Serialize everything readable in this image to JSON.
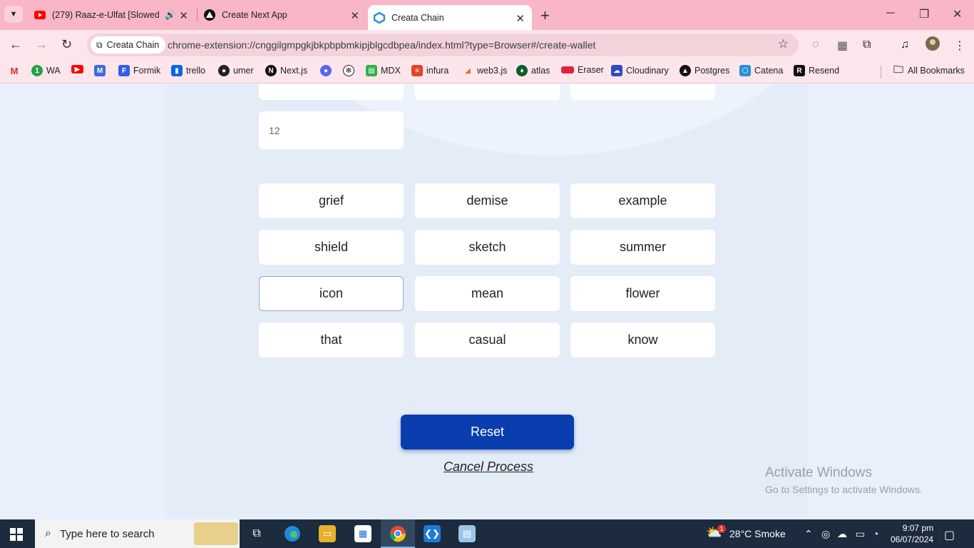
{
  "browser": {
    "tabs": [
      {
        "title": "(279) Raaz-e-Ulfat [Slowed -",
        "icon": "youtube-icon"
      },
      {
        "title": "Create Next App",
        "icon": "nextjs-icon"
      },
      {
        "title": "Creata Chain",
        "icon": "creata-chain-icon",
        "active": true
      }
    ],
    "site_chip": "Creata Chain",
    "url": "chrome-extension://cnggilgmpgkjbkpbpbmkipjblgcdbpea/index.html?type=Browser#/create-wallet",
    "bookmarks": [
      "WA",
      "Formik",
      "trello",
      "umer",
      "Next.js",
      "MDX",
      "infura",
      "web3.js",
      "atlas",
      "Eraser",
      "Cloudinary",
      "Postgres",
      "Catena",
      "Resend"
    ],
    "all_bookmarks": "All Bookmarks"
  },
  "wallet": {
    "index_value": "12",
    "words": [
      "grief",
      "demise",
      "example",
      "shield",
      "sketch",
      "summer",
      "icon",
      "mean",
      "flower",
      "that",
      "casual",
      "know"
    ],
    "reset_label": "Reset",
    "cancel_label": "Cancel Process"
  },
  "watermark": {
    "line1": "Activate Windows",
    "line2": "Go to Settings to activate Windows."
  },
  "taskbar": {
    "search_placeholder": "Type here to search",
    "weather": "28°C  Smoke",
    "weather_badge": "1",
    "time": "9:07 pm",
    "date": "06/07/2024"
  },
  "colors": {
    "tab_bar": "#f9b6c6",
    "primary_button": "#0a3db0",
    "page_background": "#e9f0fb"
  }
}
